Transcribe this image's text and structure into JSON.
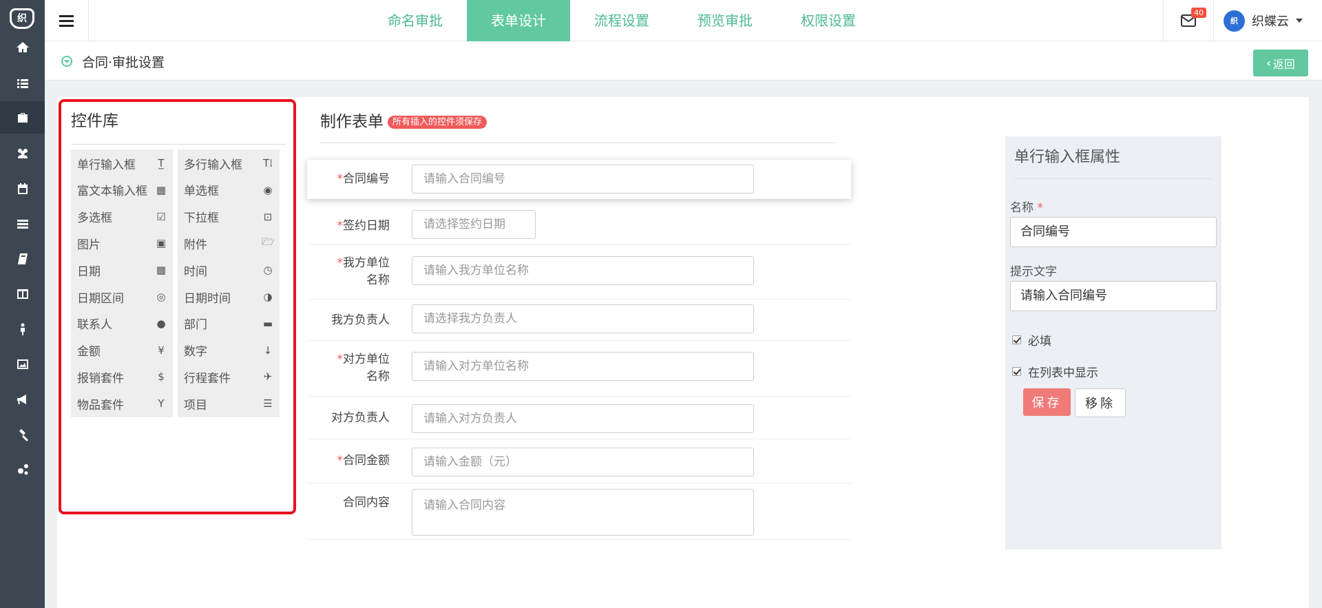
{
  "nav": {
    "logo_text": "织",
    "items": [
      {
        "icon": "home-icon"
      },
      {
        "icon": "list-icon"
      },
      {
        "icon": "briefcase-icon",
        "active": true
      },
      {
        "icon": "users-icon"
      },
      {
        "icon": "calendar-icon"
      },
      {
        "icon": "server-icon"
      },
      {
        "icon": "book-icon"
      },
      {
        "icon": "columns-icon"
      },
      {
        "icon": "person-icon"
      },
      {
        "icon": "image-icon"
      },
      {
        "icon": "megaphone-icon"
      },
      {
        "icon": "gavel-icon"
      },
      {
        "icon": "gears-icon"
      }
    ]
  },
  "header": {
    "tabs": [
      "命名审批",
      "表单设计",
      "流程设置",
      "预览审批",
      "权限设置"
    ],
    "active_tab": 1,
    "mail_badge": "40",
    "avatar_text": "织",
    "user_name": "织蝶云",
    "accent_color": "#62c8a0"
  },
  "page": {
    "title": "合同·审批设置",
    "back_label": "返回"
  },
  "library": {
    "title": "控件库",
    "controls": [
      {
        "label": "单行输入框",
        "icon": "T̲"
      },
      {
        "label": "多行输入框",
        "icon": "T⁞"
      },
      {
        "label": "富文本输入框",
        "icon": "▦"
      },
      {
        "label": "单选框",
        "icon": "◉"
      },
      {
        "label": "多选框",
        "icon": "☑"
      },
      {
        "label": "下拉框",
        "icon": "⊡"
      },
      {
        "label": "图片",
        "icon": "▣"
      },
      {
        "label": "附件",
        "icon": "🗁"
      },
      {
        "label": "日期",
        "icon": "▦"
      },
      {
        "label": "时间",
        "icon": "◷"
      },
      {
        "label": "日期区间",
        "icon": "◎"
      },
      {
        "label": "日期时间",
        "icon": "◑"
      },
      {
        "label": "联系人",
        "icon": "●"
      },
      {
        "label": "部门",
        "icon": "▬"
      },
      {
        "label": "金额",
        "icon": "¥"
      },
      {
        "label": "数字",
        "icon": "↓"
      },
      {
        "label": "报销套件",
        "icon": "$"
      },
      {
        "label": "行程套件",
        "icon": "✈"
      },
      {
        "label": "物品套件",
        "icon": "Y"
      },
      {
        "label": "项目",
        "icon": "☰"
      }
    ]
  },
  "form": {
    "title": "制作表单",
    "notice": "所有插入的控件须保存",
    "fields": [
      {
        "label": "合同编号",
        "required": "*",
        "placeholder": "请输入合同编号"
      },
      {
        "label": "签约日期",
        "required": "*",
        "placeholder": "请选择签约日期"
      },
      {
        "label": "我方单位名称",
        "label_l1": "我方单位",
        "label_l2": "名称",
        "required": "*",
        "placeholder": "请输入我方单位名称"
      },
      {
        "label": "我方负责人",
        "required": "",
        "placeholder": "请选择我方负责人"
      },
      {
        "label": "对方单位名称",
        "label_l1": "对方单位",
        "label_l2": "名称",
        "required": "*",
        "placeholder": "请输入对方单位名称"
      },
      {
        "label": "对方负责人",
        "required": "",
        "placeholder": "请输入对方负责人"
      },
      {
        "label": "合同金额",
        "required": "*",
        "placeholder": "请输入金额（元）"
      },
      {
        "label": "合同内容",
        "required": "",
        "placeholder": "请输入合同内容"
      }
    ]
  },
  "properties": {
    "title": "单行输入框属性",
    "name_label": "名称",
    "name_required": "*",
    "name_value": "合同编号",
    "hint_label": "提示文字",
    "hint_value": "请输入合同编号",
    "required_label": "必填",
    "required_checked": true,
    "show_in_list_label": "在列表中显示",
    "show_in_list_checked": true,
    "save_label": "保存",
    "remove_label": "移除"
  }
}
